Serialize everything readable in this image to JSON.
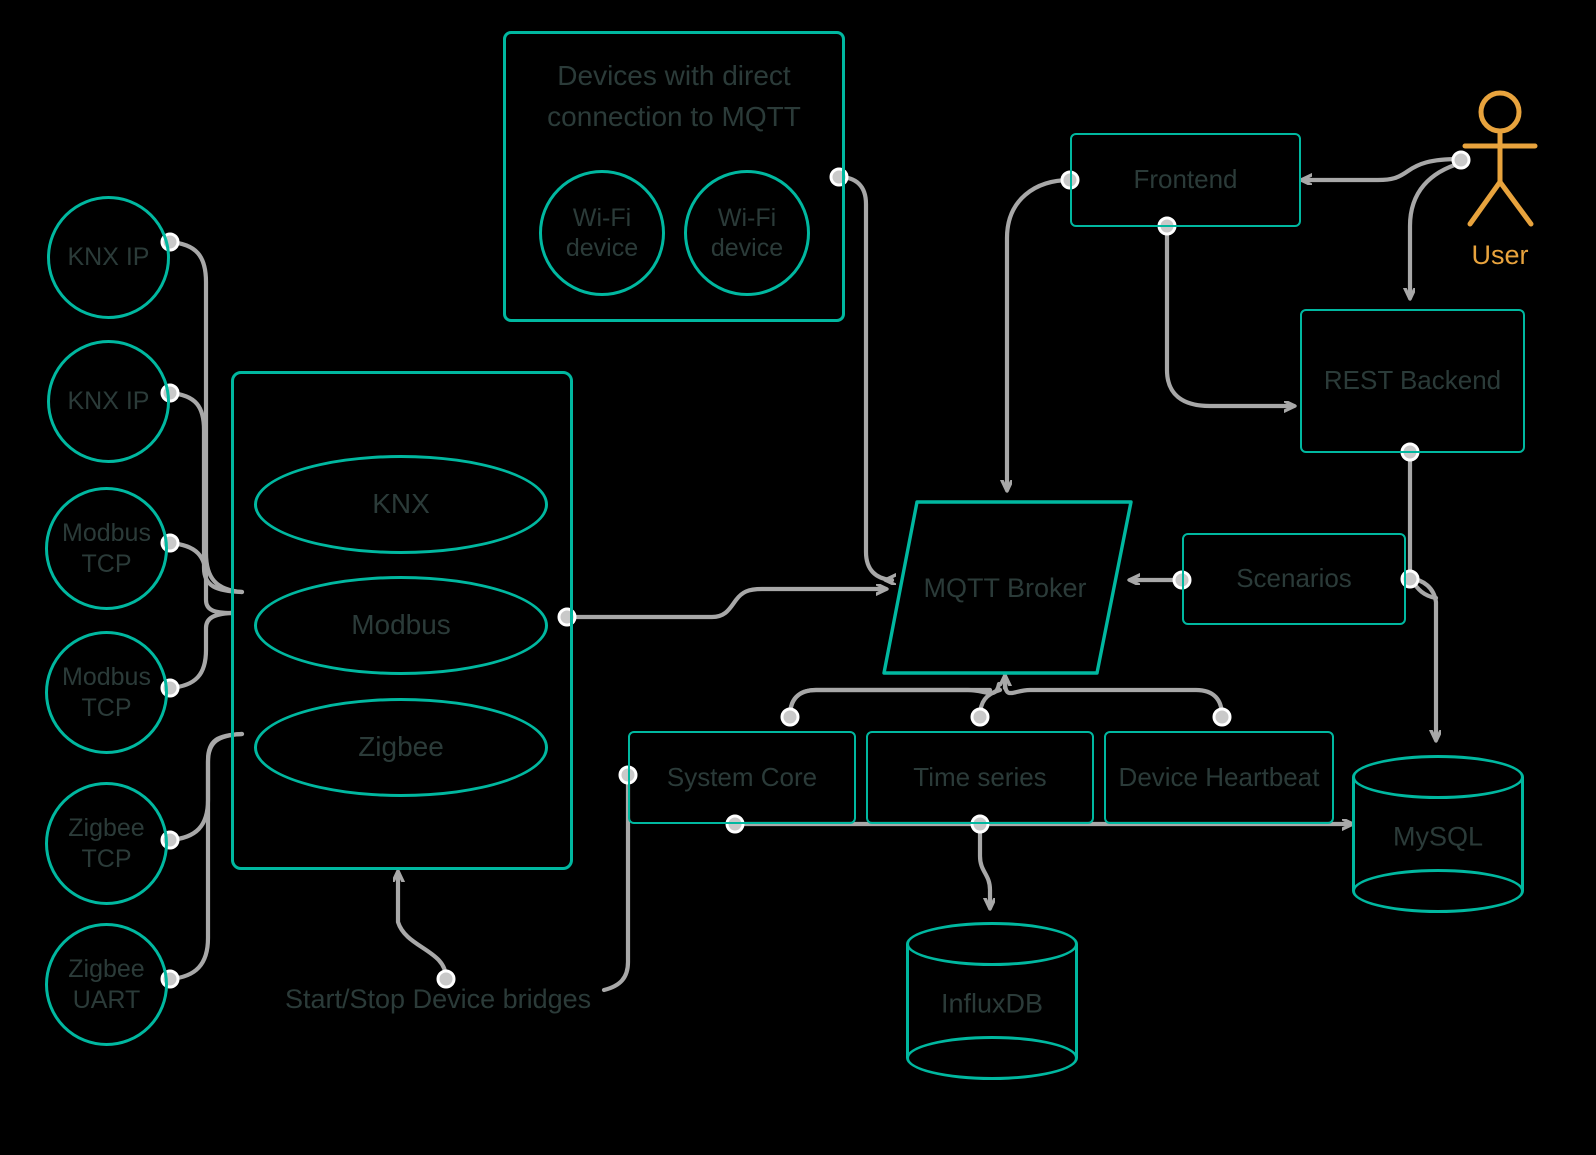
{
  "colors": {
    "background": "#000000",
    "accent_teal": "#00b8a0",
    "text": "#2b3b39",
    "wire": "#a8a8a8",
    "actor_orange": "#E8A33D"
  },
  "device_sources": [
    {
      "label": "KNX IP"
    },
    {
      "label": "KNX IP"
    },
    {
      "label": "Modbus TCP"
    },
    {
      "label": "Modbus TCP"
    },
    {
      "label": "Zigbee TCP"
    },
    {
      "label": "Zigbee UART"
    }
  ],
  "mqtt_devices_group": {
    "caption": "Devices with direct connection to MQTT",
    "devices": [
      {
        "label": "Wi-Fi device"
      },
      {
        "label": "Wi-Fi device"
      }
    ]
  },
  "bridges": {
    "items": [
      {
        "label": "KNX"
      },
      {
        "label": "Modbus"
      },
      {
        "label": "Zigbee"
      }
    ],
    "control_label": "Start/Stop Device bridges"
  },
  "broker": {
    "label": "MQTT Broker"
  },
  "services": [
    {
      "label": "System Core"
    },
    {
      "label": "Time series"
    },
    {
      "label": "Device Heartbeat"
    }
  ],
  "scenarios": {
    "label": "Scenarios"
  },
  "frontend": {
    "label": "Frontend"
  },
  "backend": {
    "label": "REST Backend"
  },
  "actor": {
    "label": "User"
  },
  "databases": [
    {
      "label": "MySQL"
    },
    {
      "label": "InfluxDB"
    }
  ]
}
